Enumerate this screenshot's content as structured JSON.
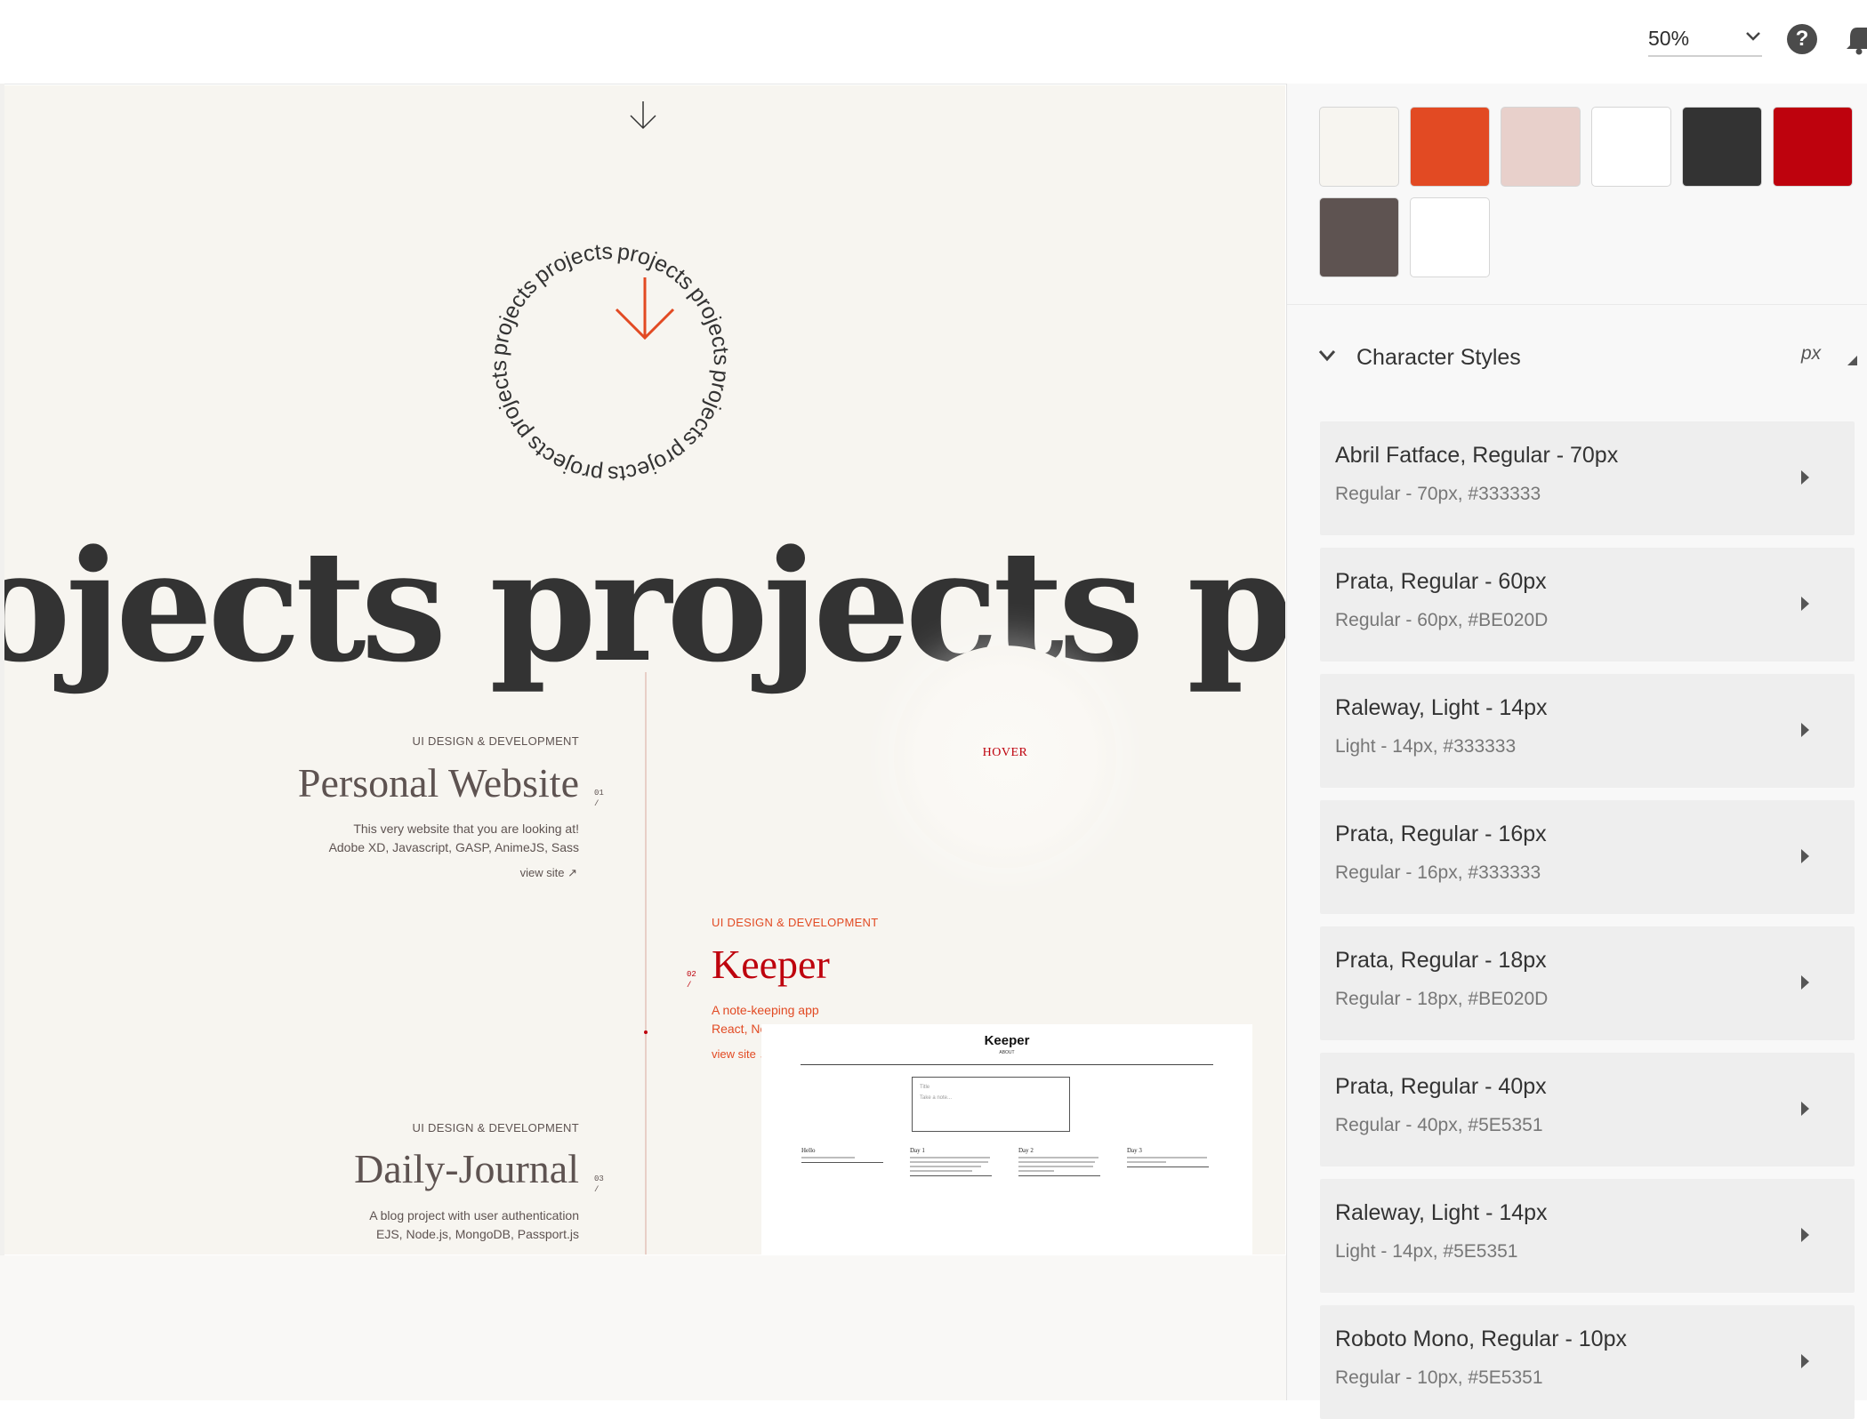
{
  "toolbar": {
    "zoom": "50%"
  },
  "artboard": {
    "ring_word": "projects",
    "marquee": "ojects projects project",
    "hover_label": "HOVER",
    "projects": [
      {
        "category": "UI DESIGN & DEVELOPMENT",
        "title": "Personal Website",
        "number": "01",
        "desc1": "This very website that you are looking at!",
        "desc2": "Adobe XD, Javascript, GASP, AnimeJS, Sass",
        "link": "view site ↗"
      },
      {
        "category": "UI DESIGN & DEVELOPMENT",
        "title": "Keeper",
        "number": "02",
        "desc1": "A note-keeping app",
        "desc2": "React, Node.js, MongoDB",
        "link": "view site ↗"
      },
      {
        "category": "UI DESIGN & DEVELOPMENT",
        "title": "Daily-Journal",
        "number": "03",
        "desc1": "A blog project with user authentication",
        "desc2": "EJS, Node.js, MongoDB, Passport.js"
      }
    ],
    "preview": {
      "title": "Keeper",
      "subtitle": "ABOUT",
      "input_title": "Title",
      "input_body": "Take a note...",
      "cards": [
        "Hello",
        "Day 1",
        "Day 2",
        "Day 3"
      ]
    }
  },
  "colors": {
    "swatches": [
      "#f7f5f0",
      "#e24a23",
      "#e8d0cb",
      "#ffffff",
      "#333333",
      "#be020d",
      "#5e5351",
      "#ffffff"
    ],
    "accent": "#be020d",
    "text_dark": "#333333"
  },
  "character_styles": {
    "title": "Character Styles",
    "unit": "px",
    "items": [
      {
        "name": "Abril Fatface, Regular - 70px",
        "detail": "Regular - 70px, #333333"
      },
      {
        "name": "Prata, Regular - 60px",
        "detail": "Regular - 60px, #BE020D"
      },
      {
        "name": "Raleway, Light - 14px",
        "detail": "Light - 14px, #333333"
      },
      {
        "name": "Prata, Regular - 16px",
        "detail": "Regular - 16px, #333333"
      },
      {
        "name": "Prata, Regular - 18px",
        "detail": "Regular - 18px, #BE020D"
      },
      {
        "name": "Prata, Regular - 40px",
        "detail": "Regular - 40px, #5E5351"
      },
      {
        "name": "Raleway, Light - 14px",
        "detail": "Light - 14px, #5E5351"
      },
      {
        "name": "Roboto Mono, Regular - 10px",
        "detail": "Regular - 10px, #5E5351"
      }
    ]
  },
  "icons": [
    "down-arrow-icon",
    "chevron-down-icon",
    "help-icon",
    "bell-icon",
    "triangle-right-icon"
  ]
}
